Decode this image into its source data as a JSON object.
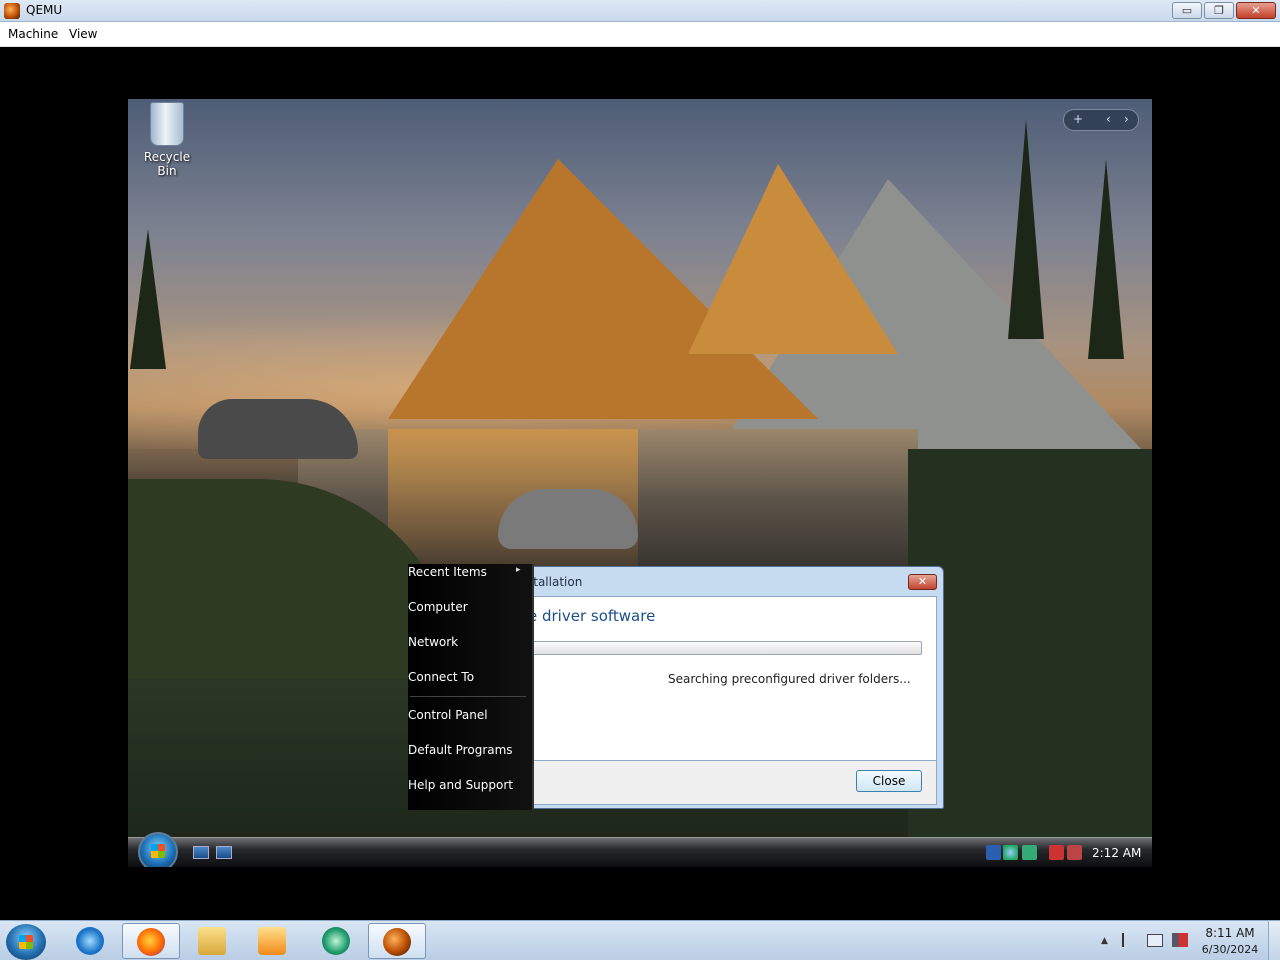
{
  "host_window": {
    "title": "QEMU",
    "menu": [
      "Machine",
      "View"
    ],
    "controls": {
      "minimize": "▭",
      "restore": "❐",
      "close": "✕"
    }
  },
  "guest": {
    "desktop_icons": [
      {
        "label": "Recycle Bin",
        "icon": "recycle-bin-icon"
      }
    ],
    "gadget_bar": {
      "add": "+",
      "prev": "‹",
      "next": "›"
    },
    "start_menu": {
      "items": [
        {
          "label": "Recent Items",
          "has_submenu": true
        },
        {
          "label": "Computer"
        },
        {
          "label": "Network"
        },
        {
          "label": "Connect To"
        },
        {
          "label": "Control Panel"
        },
        {
          "label": "Default Programs"
        },
        {
          "label": "Help and Support"
        }
      ],
      "submenu_arrow": "▸"
    },
    "dialog": {
      "title": "stallation",
      "heading": "e driver software",
      "status": "Searching preconfigured driver folders...",
      "progress": 0,
      "close_button": "Close",
      "close_glyph": "✕"
    },
    "taskbar": {
      "clock": "2:12 AM",
      "tray_icons": [
        "network-icon",
        "network-activity-icon",
        "security-check-icon",
        "network-disconnected-icon",
        "volume-muted-icon"
      ]
    }
  },
  "host_taskbar": {
    "pinned": [
      "internet-explorer-icon",
      "firefox-icon",
      "file-explorer-icon",
      "media-player-icon",
      "app-icon",
      "qemu-icon"
    ],
    "tray": {
      "show_hidden": "▲"
    },
    "time": "8:11 AM",
    "date": "6/30/2024"
  }
}
